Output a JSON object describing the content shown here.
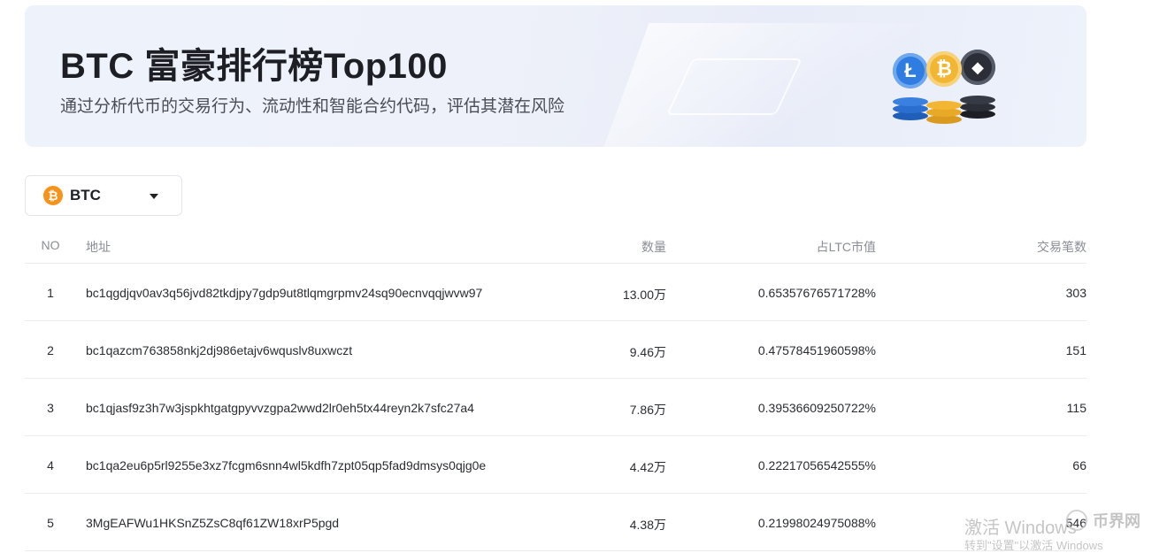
{
  "banner": {
    "title": "BTC 富豪排行榜Top100",
    "subtitle": "通过分析代币的交易行为、流动性和智能合约代码，评估其潜在风险",
    "coin_glyphs": [
      "Ł",
      "₿",
      "◆"
    ]
  },
  "selector": {
    "icon_glyph": "₿",
    "value": "BTC"
  },
  "table": {
    "headers": {
      "no": "NO",
      "address": "地址",
      "amount": "数量",
      "percent": "占LTC市值",
      "count": "交易笔数"
    },
    "rows": [
      {
        "no": "1",
        "address": "bc1qgdjqv0av3q56jvd82tkdjpy7gdp9ut8tlqmgrpmv24sq90ecnvqqjwvw97",
        "amount": "13.00万",
        "percent": "0.65357676571728%",
        "count": "303"
      },
      {
        "no": "2",
        "address": "bc1qazcm763858nkj2dj986etajv6wquslv8uxwczt",
        "amount": "9.46万",
        "percent": "0.47578451960598%",
        "count": "151"
      },
      {
        "no": "3",
        "address": "bc1qjasf9z3h7w3jspkhtgatgpyvvzgpa2wwd2lr0eh5tx44reyn2k7sfc27a4",
        "amount": "7.86万",
        "percent": "0.39536609250722%",
        "count": "115"
      },
      {
        "no": "4",
        "address": "bc1qa2eu6p5rl9255e3xz7fcgm6snn4wl5kdfh7zpt05qp5fad9dmsys0qjg0e",
        "amount": "4.42万",
        "percent": "0.22217056542555%",
        "count": "66"
      },
      {
        "no": "5",
        "address": "3MgEAFWu1HKSnZ5ZsC8qf61ZW18xrP5pgd",
        "amount": "4.38万",
        "percent": "0.21998024975088%",
        "count": "546"
      }
    ]
  },
  "watermark": {
    "line1": "激活 Windows",
    "line2": "转到\"设置\"以激活 Windows",
    "logo_text": "币界网"
  },
  "colors": {
    "btc_orange": "#f7931a",
    "ltc_blue": "#2f7de1",
    "eth_dark": "#2b2e36",
    "gold": "#f2b632"
  }
}
